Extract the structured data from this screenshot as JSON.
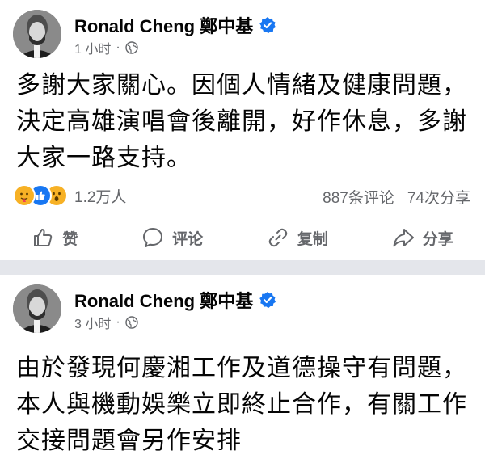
{
  "post1": {
    "author": "Ronald Cheng 鄭中基",
    "time": "1 小时",
    "text": "多謝大家關心。因個人情緒及健康問題，決定高雄演唱會後離開，好作休息，多謝大家一路支持。",
    "reaction_count": "1.2万人",
    "comments": "887条评论",
    "shares": "74次分享",
    "actions": {
      "like": "赞",
      "comment": "评论",
      "copy": "复制",
      "share": "分享"
    }
  },
  "post2": {
    "author": "Ronald Cheng 鄭中基",
    "time": "3 小时",
    "text": "由於發現何慶湘工作及道德操守有問題，本人與機動娛樂立即終止合作，有關工作交接問題會另作安排"
  },
  "colors": {
    "verified": "#1877f2",
    "secondary_text": "#65676b",
    "divider": "#e4e6eb"
  },
  "icons": [
    "verified-badge-icon",
    "globe-icon",
    "thumbs-up-icon",
    "comment-bubble-icon",
    "copy-link-icon",
    "share-arrow-icon"
  ]
}
